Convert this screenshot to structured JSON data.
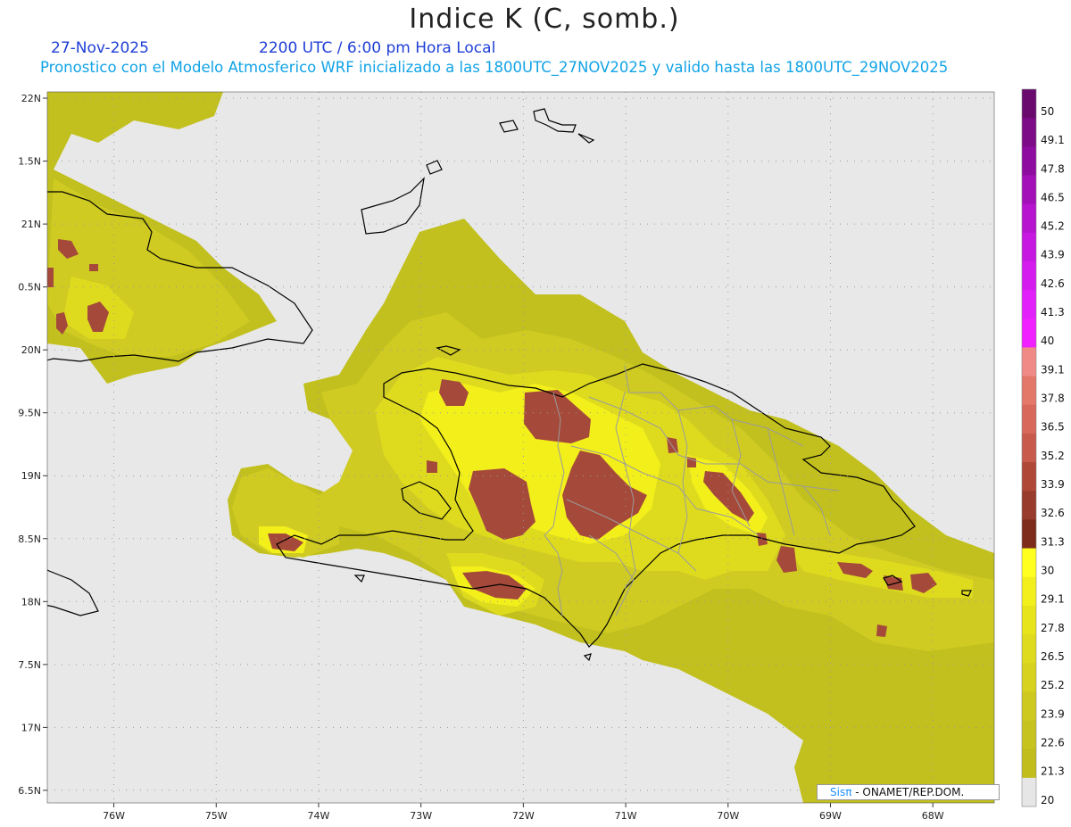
{
  "header": {
    "title": "Indice K (C, somb.)",
    "date": "27-Nov-2025",
    "time": "2200 UTC / 6:00 pm Hora Local",
    "subtitle": "Pronostico con el Modelo Atmosferico WRF inicializado a las 1800UTC_27NOV2025 y valido hasta las  1800UTC_29NOV2025"
  },
  "map": {
    "lon_labels": [
      "76W",
      "75W",
      "74W",
      "73W",
      "72W",
      "71W",
      "70W",
      "69W",
      "68W"
    ],
    "lat_labels": [
      "22N",
      "1.5N",
      "21N",
      "0.5N",
      "20N",
      "9.5N",
      "19N",
      "8.5N",
      "18N",
      "7.5N",
      "17N",
      "6.5N"
    ],
    "lon_range": [
      -76.65,
      -67.4
    ],
    "lat_range": [
      16.4,
      22.05
    ],
    "colors": {
      "background": "#e8e8e8",
      "level_20": "#c2c01e",
      "level_22": "#cfcb22",
      "level_25": "#dedb1f",
      "level_28": "#f2ef1b",
      "level_30": "#a54a3a",
      "level_33": "#b55a4c",
      "coast": "#000000",
      "borders": "#9b9b9b"
    }
  },
  "colorbar": {
    "labels": [
      "50",
      "49.1",
      "47.8",
      "46.5",
      "45.2",
      "43.9",
      "42.6",
      "41.3",
      "40",
      "39.1",
      "37.8",
      "36.5",
      "35.2",
      "33.9",
      "32.6",
      "31.3",
      "30",
      "29.1",
      "27.8",
      "26.5",
      "25.2",
      "23.9",
      "22.6",
      "21.3",
      "20"
    ],
    "colors": [
      "#6a0a6e",
      "#7d0a86",
      "#8f0ca0",
      "#a410b8",
      "#b614cf",
      "#c618e0",
      "#d41cef",
      "#e220fa",
      "#f020ff",
      "#f08a86",
      "#e47868",
      "#d8685a",
      "#c85a4c",
      "#b04838",
      "#983a2c",
      "#7e2c1c",
      "#ffff20",
      "#f2ef1c",
      "#e8e41c",
      "#dedb1f",
      "#d6d21e",
      "#cdc91e",
      "#c6c31e",
      "#c0bd1c",
      "#e6e6e6"
    ]
  },
  "credit": {
    "brand": "Sisπ",
    "text": " - ONAMET/REP.DOM."
  }
}
